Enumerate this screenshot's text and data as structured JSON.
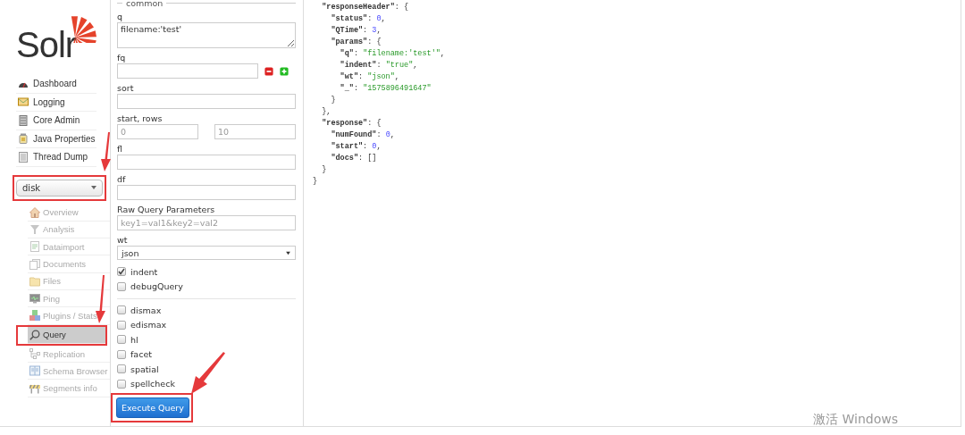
{
  "sidebar": {
    "logo": {
      "text": "Solr"
    },
    "nav": [
      {
        "label": "Dashboard"
      },
      {
        "label": "Logging"
      },
      {
        "label": "Core Admin"
      },
      {
        "label": "Java Properties"
      },
      {
        "label": "Thread Dump"
      }
    ],
    "core_select": {
      "value": "disk",
      "highlighted": true
    },
    "core_items": [
      {
        "label": "Overview",
        "disabled": true,
        "selected": false,
        "highlighted": false
      },
      {
        "label": "Analysis",
        "disabled": true,
        "selected": false,
        "highlighted": false
      },
      {
        "label": "Dataimport",
        "disabled": true,
        "selected": false,
        "highlighted": false
      },
      {
        "label": "Documents",
        "disabled": true,
        "selected": false,
        "highlighted": false
      },
      {
        "label": "Files",
        "disabled": true,
        "selected": false,
        "highlighted": false
      },
      {
        "label": "Ping",
        "disabled": true,
        "selected": false,
        "highlighted": false
      },
      {
        "label": "Plugins / Stats",
        "disabled": true,
        "selected": false,
        "highlighted": false
      },
      {
        "label": "Query",
        "disabled": false,
        "selected": true,
        "highlighted": true
      },
      {
        "label": "Replication",
        "disabled": true,
        "selected": false,
        "highlighted": false
      },
      {
        "label": "Schema Browser",
        "disabled": true,
        "selected": false,
        "highlighted": false
      },
      {
        "label": "Segments info",
        "disabled": true,
        "selected": false,
        "highlighted": false
      }
    ]
  },
  "query_form": {
    "legend": "common",
    "fields": [
      {
        "kind": "textarea",
        "label": "q",
        "value": "filename:'test'"
      },
      {
        "kind": "multi",
        "label": "fq"
      },
      {
        "kind": "text",
        "label": "sort"
      },
      {
        "kind": "pair",
        "label": "start, rows",
        "placeholders": [
          "0",
          "10"
        ]
      },
      {
        "kind": "text",
        "label": "fl"
      },
      {
        "kind": "text",
        "label": "df"
      },
      {
        "kind": "text",
        "label": "Raw Query Parameters",
        "placeholder": "key1=val1&key2=val2"
      },
      {
        "kind": "select",
        "label": "wt",
        "value": "json"
      }
    ],
    "flags": [
      {
        "label": "indent",
        "checked": true
      },
      {
        "label": "debugQuery",
        "checked": false
      }
    ],
    "components": [
      {
        "label": "dismax",
        "checked": false
      },
      {
        "label": "edismax",
        "checked": false
      },
      {
        "label": "hl",
        "checked": false
      },
      {
        "label": "facet",
        "checked": false
      },
      {
        "label": "spatial",
        "checked": false
      },
      {
        "label": "spellcheck",
        "checked": false
      }
    ],
    "execute_button": {
      "label": "Execute Query",
      "highlighted": true
    }
  },
  "response_lines": [
    [
      {
        "kind": "k",
        "text": "  \"responseHeader\""
      },
      {
        "kind": "p",
        "text": ": {"
      }
    ],
    [
      {
        "kind": "k",
        "text": "    \"status\""
      },
      {
        "kind": "p",
        "text": ": "
      },
      {
        "kind": "n",
        "text": "0"
      },
      {
        "kind": "p",
        "text": ","
      }
    ],
    [
      {
        "kind": "k",
        "text": "    \"QTime\""
      },
      {
        "kind": "p",
        "text": ": "
      },
      {
        "kind": "n",
        "text": "3"
      },
      {
        "kind": "p",
        "text": ","
      }
    ],
    [
      {
        "kind": "k",
        "text": "    \"params\""
      },
      {
        "kind": "p",
        "text": ": {"
      }
    ],
    [
      {
        "kind": "k",
        "text": "      \"q\""
      },
      {
        "kind": "p",
        "text": ": "
      },
      {
        "kind": "s",
        "text": "\"filename:'test'\""
      },
      {
        "kind": "p",
        "text": ","
      }
    ],
    [
      {
        "kind": "k",
        "text": "      \"indent\""
      },
      {
        "kind": "p",
        "text": ": "
      },
      {
        "kind": "s",
        "text": "\"true\""
      },
      {
        "kind": "p",
        "text": ","
      }
    ],
    [
      {
        "kind": "k",
        "text": "      \"wt\""
      },
      {
        "kind": "p",
        "text": ": "
      },
      {
        "kind": "s",
        "text": "\"json\""
      },
      {
        "kind": "p",
        "text": ","
      }
    ],
    [
      {
        "kind": "k",
        "text": "      \"_\""
      },
      {
        "kind": "p",
        "text": ": "
      },
      {
        "kind": "s",
        "text": "\"1575896491647\""
      }
    ],
    [
      {
        "kind": "p",
        "text": "    }"
      }
    ],
    [
      {
        "kind": "p",
        "text": "  },"
      }
    ],
    [
      {
        "kind": "k",
        "text": "  \"response\""
      },
      {
        "kind": "p",
        "text": ": {"
      }
    ],
    [
      {
        "kind": "k",
        "text": "    \"numFound\""
      },
      {
        "kind": "p",
        "text": ": "
      },
      {
        "kind": "n",
        "text": "0"
      },
      {
        "kind": "p",
        "text": ","
      }
    ],
    [
      {
        "kind": "k",
        "text": "    \"start\""
      },
      {
        "kind": "p",
        "text": ": "
      },
      {
        "kind": "n",
        "text": "0"
      },
      {
        "kind": "p",
        "text": ","
      }
    ],
    [
      {
        "kind": "k",
        "text": "    \"docs\""
      },
      {
        "kind": "p",
        "text": ": []"
      }
    ],
    [
      {
        "kind": "p",
        "text": "  }"
      }
    ],
    [
      {
        "kind": "p",
        "text": "}"
      }
    ]
  ],
  "os_overlay": {
    "text": "激活 Windows"
  }
}
